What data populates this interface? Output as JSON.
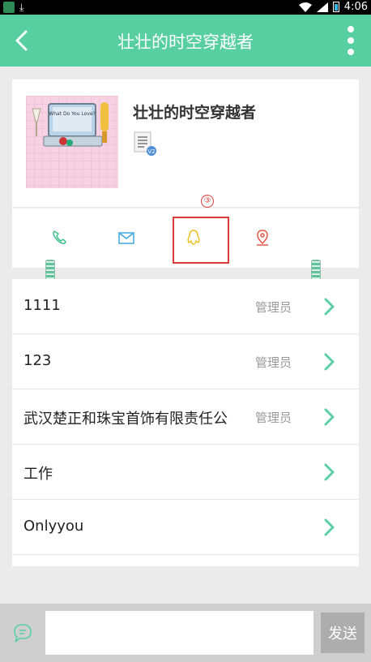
{
  "status_bar": {
    "time": "4:06",
    "icons": [
      "app-icon",
      "download-icon",
      "wifi-icon",
      "signal-icon",
      "battery-icon"
    ]
  },
  "toolbar": {
    "title": "壮壮的时空穿越者",
    "back_icon": "back-arrow-icon",
    "more_icon": "more-vert-icon"
  },
  "profile": {
    "name": "壮壮的时空穿越者",
    "avatar_text": "What Do You Love?"
  },
  "contact_icons": [
    "phone-icon",
    "mail-icon",
    "qq-icon",
    "location-icon"
  ],
  "annotation": {
    "marker": "③"
  },
  "members": [
    {
      "name": "1111",
      "role": "管理员"
    },
    {
      "name": "123",
      "role": "管理员"
    },
    {
      "name": "武汉楚正和珠宝首饰有限责任公",
      "role": "管理员"
    },
    {
      "name": "工作",
      "role": ""
    },
    {
      "name": "Onlyyou",
      "role": ""
    }
  ],
  "input_bar": {
    "placeholder": "",
    "send_label": "发送"
  },
  "colors": {
    "accent": "#57cfa0",
    "highlight": "#e03a3a",
    "chevron": "#5ccfa8"
  }
}
